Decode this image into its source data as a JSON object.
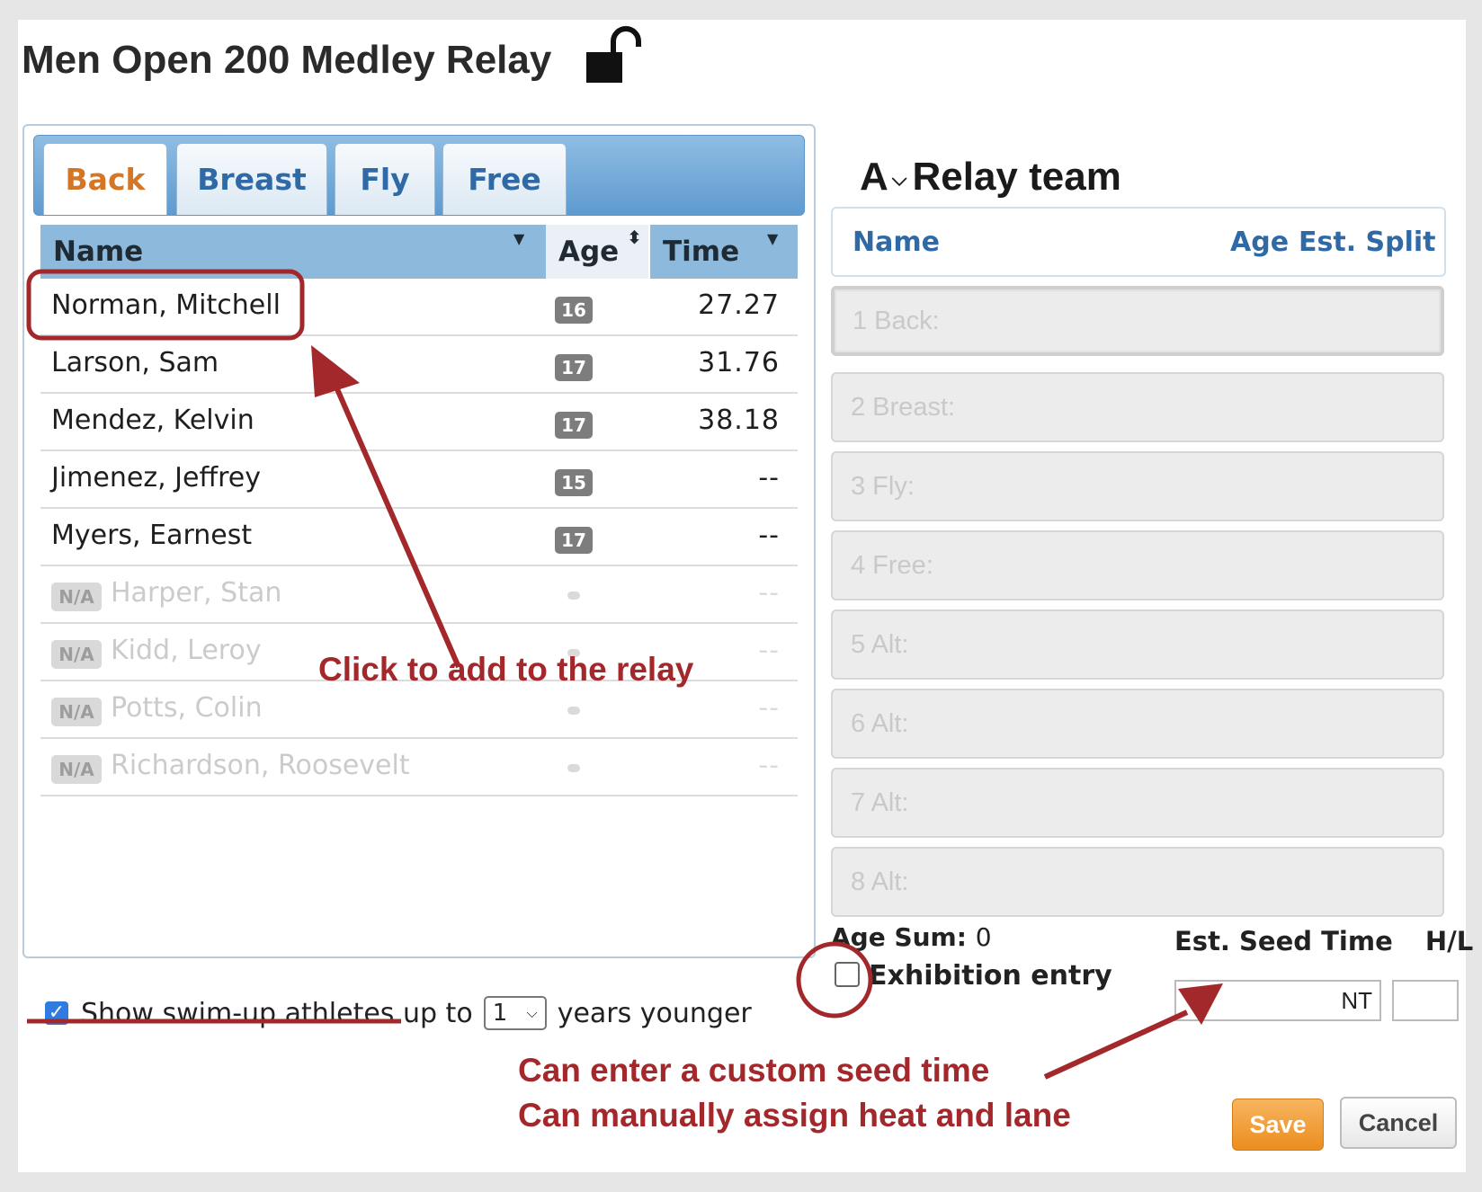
{
  "event": {
    "title": "Men Open 200 Medley Relay",
    "lock_icon": "unlock-icon"
  },
  "tabs": [
    {
      "label": "Back",
      "active": true
    },
    {
      "label": "Breast",
      "active": false
    },
    {
      "label": "Fly",
      "active": false
    },
    {
      "label": "Free",
      "active": false
    }
  ],
  "table": {
    "headers": {
      "name": "Name",
      "age": "Age",
      "time": "Time"
    },
    "rows": [
      {
        "name": "Norman, Mitchell",
        "age": "16",
        "time": "27.27"
      },
      {
        "name": "Larson, Sam",
        "age": "17",
        "time": "31.76"
      },
      {
        "name": "Mendez, Kelvin",
        "age": "17",
        "time": "38.18"
      },
      {
        "name": "Jimenez, Jeffrey",
        "age": "15",
        "time": "--"
      },
      {
        "name": "Myers, Earnest",
        "age": "17",
        "time": "--"
      }
    ],
    "na_rows": [
      {
        "badge": "N/A",
        "name": "Harper, Stan",
        "time": "--"
      },
      {
        "badge": "N/A",
        "name": "Kidd, Leroy",
        "time": "--"
      },
      {
        "badge": "N/A",
        "name": "Potts, Colin",
        "time": "--"
      },
      {
        "badge": "N/A",
        "name": "Richardson, Roosevelt",
        "time": "--"
      }
    ]
  },
  "swimup": {
    "checked": true,
    "label": "Show swim-up athletes up to",
    "value": "1",
    "suffix": "years younger"
  },
  "relay": {
    "team_letter": "A",
    "title": "Relay team",
    "headers": {
      "name": "Name",
      "age": "Age",
      "split": "Est. Split"
    },
    "slots": [
      "1 Back:",
      "2 Breast:",
      "3 Fly:",
      "4 Free:",
      "5 Alt:",
      "6 Alt:",
      "7 Alt:",
      "8 Alt:"
    ],
    "age_sum_label": "Age Sum:",
    "age_sum_value": "0",
    "exhibition_label": "Exhibition entry",
    "seed_time_label": "Est. Seed Time",
    "seed_time_value": "NT",
    "hl_label": "H/L"
  },
  "buttons": {
    "save": "Save",
    "cancel": "Cancel"
  },
  "annotations": {
    "click_hint": "Click to add to the relay",
    "seed_hint": "Can enter a custom seed time",
    "lane_hint": "Can manually assign heat and lane"
  },
  "colors": {
    "annotation": "#a3282b",
    "tab_active": "#d57627",
    "link_blue": "#2f6aa6",
    "save_orange": "#ec8d1e"
  }
}
